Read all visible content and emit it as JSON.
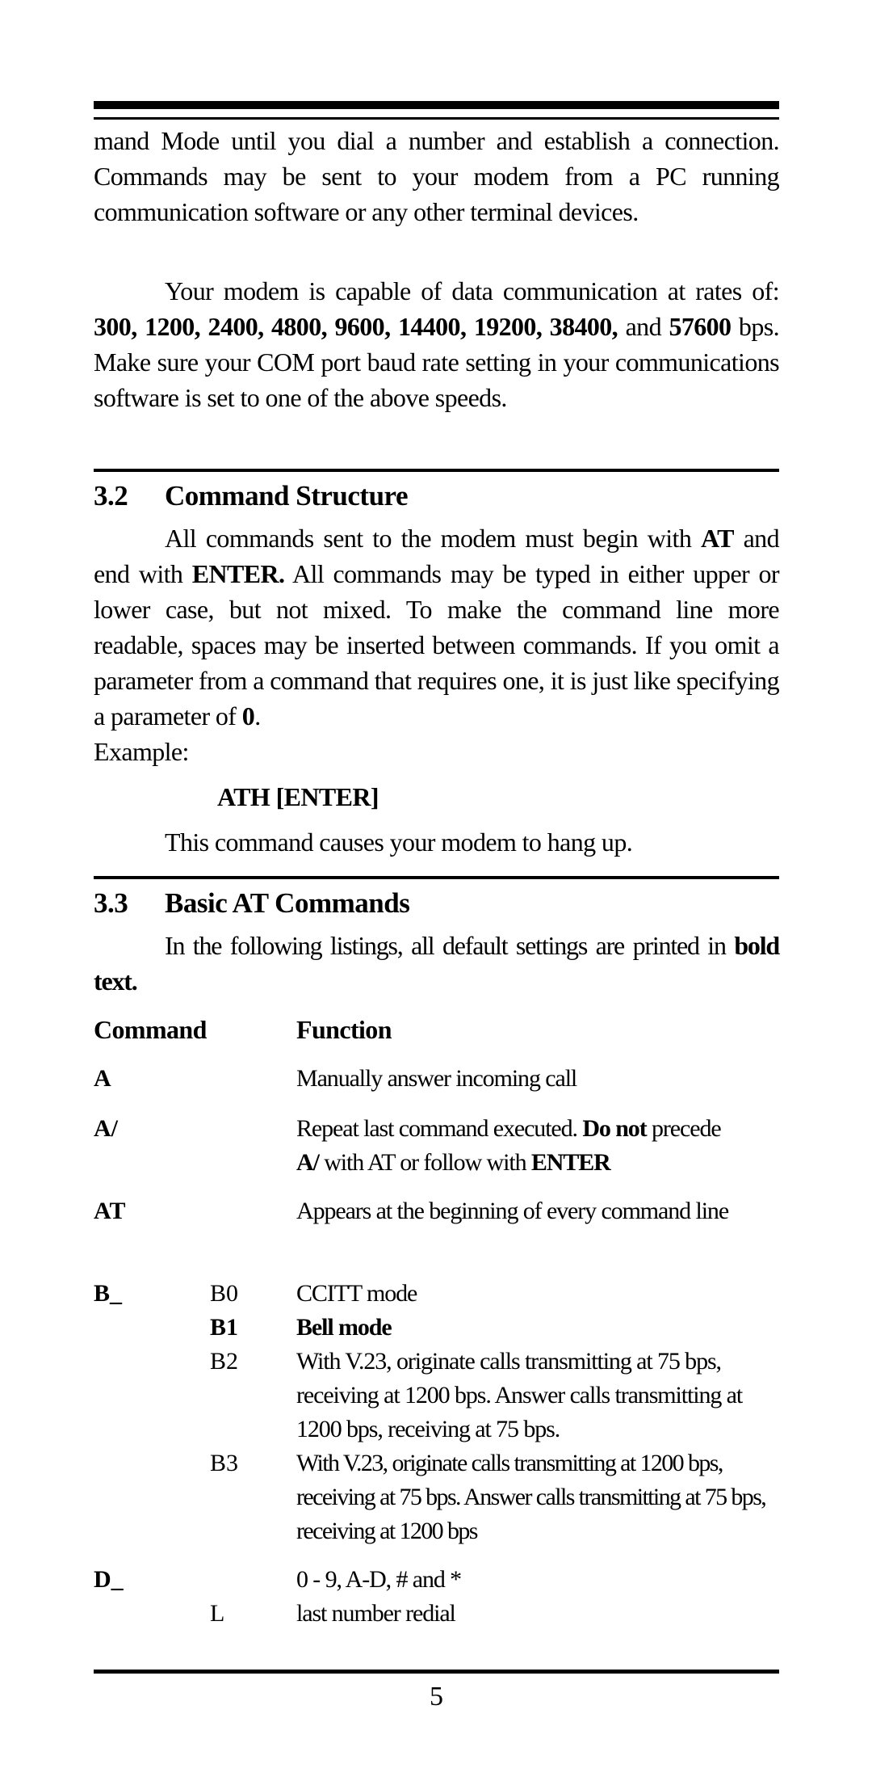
{
  "continuation": {
    "text": "mand Mode until you dial a number and establish a connection. Commands may be sent to your modem from a PC running communication software or any other terminal devices.",
    "lines": [
      "mand Mode until you dial a number and establish a connec-",
      "tion. Commands may be sent to your modem from a PC",
      "running communication software or any other terminal de-",
      "vices."
    ]
  },
  "rates_paragraph": {
    "intro": "Your modem is capable of data communication at rates of: ",
    "rates_bold": "300, 1200, 2400, 4800, 9600, 14400, 19200, 38400,",
    "and": " and ",
    "last_rate_bold": "57600",
    "rest": " bps. Make sure your COM port baud rate setting in your communications software is set to one of the above speeds."
  },
  "section_3_2": {
    "number": "3.2",
    "title": "Command Structure",
    "p1_a": "All commands sent to the modem must begin with ",
    "p1_at": "AT",
    "p1_b": " and end with ",
    "p1_enter": "ENTER.",
    "p1_c": " All commands may be typed in either upper or lower case, but not mixed. To make the command line more readable, spaces may be inserted between commands. If you omit a parameter from a command that requires one, it is just like specifying a parameter of ",
    "p1_zero": "0",
    "p1_d": ".",
    "example_label": "Example:",
    "example_command": "ATH [ENTER]",
    "example_description": "This command causes your modem to hang up."
  },
  "section_3_3": {
    "number": "3.3",
    "title": "Basic AT Commands",
    "intro_a": "In the following listings, all default settings are printed in ",
    "intro_bold": "bold text.",
    "column_headers": {
      "command": "Command",
      "function": "Function"
    },
    "commands": [
      {
        "command": "A",
        "entries": [
          {
            "param": "",
            "function": "Manually answer incoming call",
            "default": false
          }
        ]
      },
      {
        "command": "A/",
        "entries": [
          {
            "param": "",
            "function_parts": [
              {
                "text": "Repeat last command executed. ",
                "bold": false
              },
              {
                "text": "Do not",
                "bold": true
              },
              {
                "text": " precede ",
                "bold": false
              },
              {
                "text": "A/",
                "bold": true
              },
              {
                "text": " with AT or follow with ",
                "bold": false
              },
              {
                "text": "ENTER",
                "bold": true
              }
            ],
            "default": false
          }
        ]
      },
      {
        "command": "AT",
        "entries": [
          {
            "param": "",
            "function": "Appears at the beginning of every command line",
            "default": false
          }
        ]
      },
      {
        "command": "B_",
        "entries": [
          {
            "param": "B0",
            "function": "CCITT mode",
            "default": false
          },
          {
            "param": "B1",
            "function": "Bell mode",
            "default": true
          },
          {
            "param": "B2",
            "function": "With V.23, originate calls transmitting at 75 bps, receiving at 1200 bps. Answer calls transmitting at 1200 bps, receiving at 75 bps.",
            "default": false
          },
          {
            "param": "B3",
            "function": "With V.23, originate calls transmitting at 1200 bps, receiving at 75 bps. Answer calls transmitting at 75 bps, receiving at 1200 bps",
            "default": false
          }
        ]
      },
      {
        "command": "D_",
        "entries": [
          {
            "param": "",
            "function": "0 - 9, A-D, # and *",
            "default": false
          },
          {
            "param": "L",
            "function": "last number redial",
            "default": false
          }
        ]
      }
    ]
  },
  "footer": {
    "page_number": "5"
  }
}
